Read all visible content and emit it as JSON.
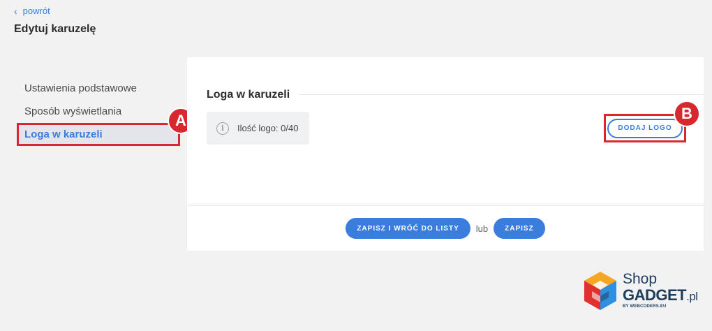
{
  "header": {
    "back_label": "powrót",
    "title": "Edytuj karuzelę"
  },
  "sidebar": {
    "items": [
      {
        "label": "Ustawienia podstawowe",
        "active": false
      },
      {
        "label": "Sposób wyświetlania",
        "active": false
      },
      {
        "label": "Loga w karuzeli",
        "active": true
      }
    ]
  },
  "main": {
    "section_title": "Loga w karuzeli",
    "logo_count": "Ilość logo: 0/40",
    "add_logo_label": "DODAJ LOGO"
  },
  "footer": {
    "save_and_return_label": "ZAPISZ I WRÓĆ DO LISTY",
    "or_label": "lub",
    "save_label": "ZAPISZ"
  },
  "annotations": {
    "a": "A",
    "b": "B"
  },
  "brand": {
    "shop": "Shop",
    "gadget": "GADGET",
    "tld": ".pl",
    "by": "BY WEBCODERS.EU"
  },
  "colors": {
    "accent": "#3b7ddd",
    "highlight": "#d7282f",
    "background": "#f2f2f3"
  }
}
